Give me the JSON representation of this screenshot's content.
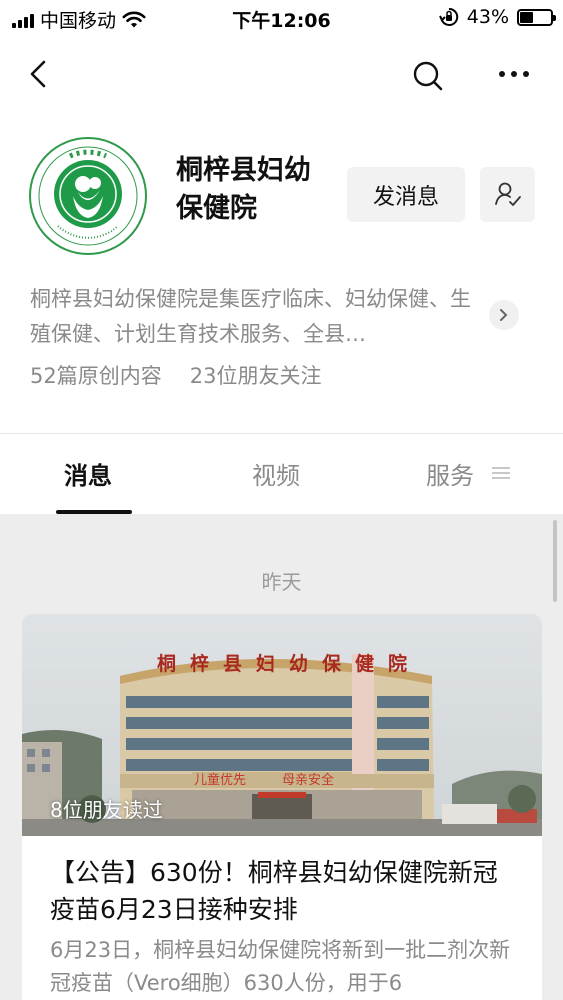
{
  "status_bar": {
    "carrier": "中国移动",
    "time": "下午12:06",
    "battery": "43%",
    "battery_level": 0.43
  },
  "nav": {
    "back_icon": "chevron-left-icon",
    "search_icon": "search-icon",
    "more_icon": "more-horizontal-icon"
  },
  "profile": {
    "name": "桐梓县妇幼保健院",
    "message_button": "发消息",
    "follow_icon": "person-check-icon",
    "description": "桐梓县妇幼保健院是集医疗临床、妇幼保健、生殖保健、计划生育技术服务、全县…",
    "stats": {
      "articles": "52篇原创内容",
      "followers": "23位朋友关注"
    }
  },
  "tabs": [
    {
      "label": "消息",
      "active": true
    },
    {
      "label": "视频",
      "active": false
    },
    {
      "label": "服务",
      "active": false
    }
  ],
  "feed": {
    "date": "昨天",
    "article": {
      "read_count": "8位朋友读过",
      "title": "【公告】630份！桐梓县妇幼保健院新冠疫苗6月23日接种安排",
      "summary": "6月23日，桐梓县妇幼保健院将新到一批二剂次新冠疫苗（Vero细胞）630人份，用于6",
      "image": {
        "building_sign": "桐梓县妇幼保健院",
        "banner_left": "儿童优先",
        "banner_right": "母亲安全",
        "vertical_banner": "保护 促进 支持母乳喂养"
      }
    }
  }
}
